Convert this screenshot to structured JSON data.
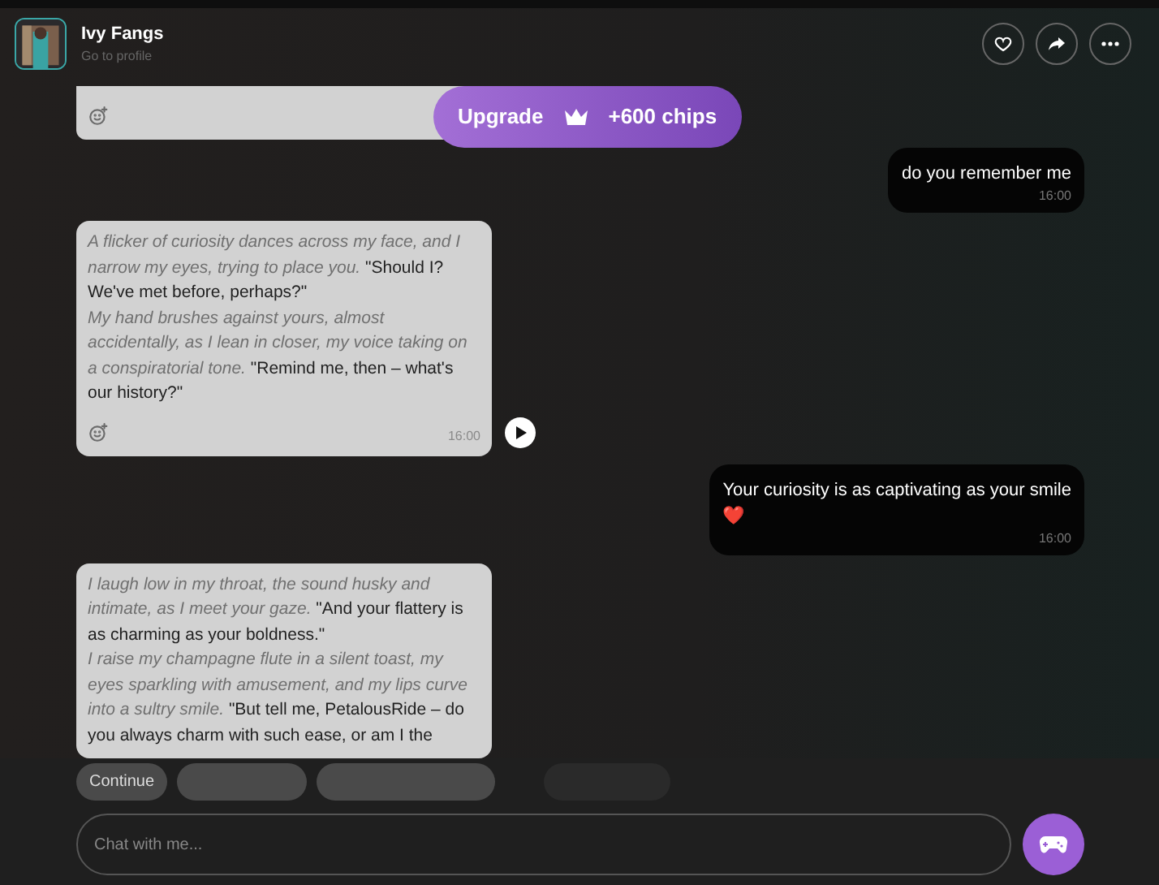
{
  "header": {
    "name": "Ivy Fangs",
    "subtitle": "Go to profile"
  },
  "upgrade": {
    "label": "Upgrade",
    "chips": "+600 chips"
  },
  "messages": [
    {
      "kind": "bot"
    },
    {
      "kind": "user",
      "text": "do you remember me",
      "time": "16:00"
    },
    {
      "kind": "bot",
      "text": "*A flicker of curiosity dances across my face, and I narrow my eyes, trying to place you.* \"Should I? We've met before, perhaps?\"\n*My hand brushes against yours, almost accidentally, as I lean in closer, my voice taking on a conspiratorial tone.* \"Remind me, then – what's our history?\"",
      "time": "16:00",
      "play": true
    },
    {
      "kind": "user",
      "text": "Your curiosity is as captivating as your smile",
      "emoji": "❤️",
      "time": "16:00"
    },
    {
      "kind": "bot",
      "text": "*I laugh low in my throat, the sound husky and intimate, as I meet your gaze.* \"And your flattery is as charming as your boldness.\"\n*I raise my champagne flute in a silent toast, my eyes sparkling with amusement, and my lips curve into a sultry smile.* \"But tell me, PetalousRide – do you always charm with such ease, or am I the"
    }
  ],
  "suggestions": [
    "Continue"
  ],
  "input": {
    "placeholder": "Chat with me..."
  }
}
